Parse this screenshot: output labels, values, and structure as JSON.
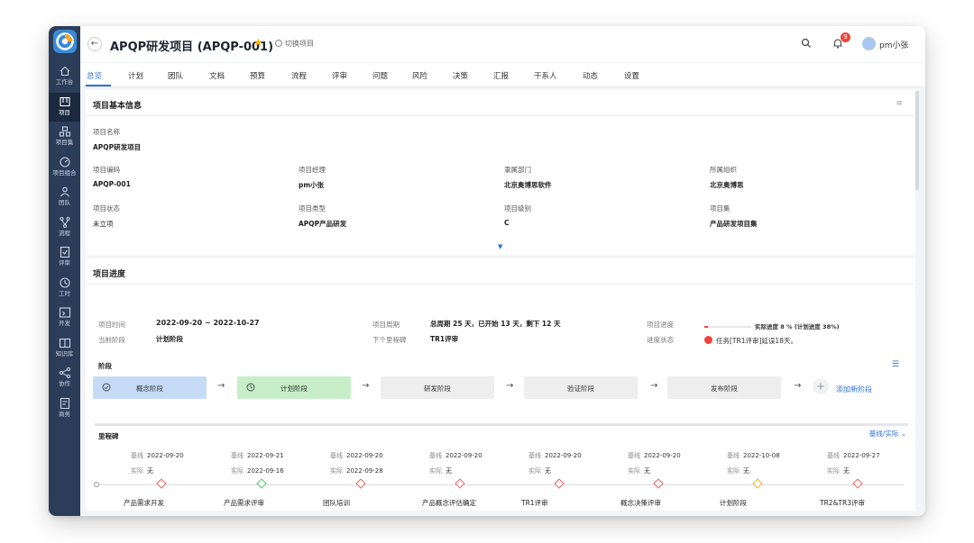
{
  "app": {
    "accent": "#2a6fdb"
  },
  "sidebar": {
    "items": [
      {
        "label": "工作台",
        "icon": "home-icon"
      },
      {
        "label": "项目",
        "icon": "project-icon"
      },
      {
        "label": "项目集",
        "icon": "project-set-icon"
      },
      {
        "label": "项目组合",
        "icon": "portfolio-icon"
      },
      {
        "label": "团队",
        "icon": "team-icon"
      },
      {
        "label": "流程",
        "icon": "process-icon"
      },
      {
        "label": "评审",
        "icon": "review-icon"
      },
      {
        "label": "工时",
        "icon": "clock-icon"
      },
      {
        "label": "开发",
        "icon": "dev-icon"
      },
      {
        "label": "知识库",
        "icon": "knowledge-icon"
      },
      {
        "label": "协作",
        "icon": "share-icon"
      },
      {
        "label": "商务",
        "icon": "business-icon"
      }
    ]
  },
  "header": {
    "back": "←",
    "title": "APQP研发项目 (APQP-001)",
    "star": "★",
    "switch_label": "切换项目",
    "notifications": "9",
    "user": "pm小张"
  },
  "tabs": [
    "总览",
    "计划",
    "团队",
    "文档",
    "预算",
    "流程",
    "评审",
    "问题",
    "风险",
    "决策",
    "汇报",
    "干系人",
    "动态",
    "设置"
  ],
  "basic_info": {
    "title": "项目基本信息",
    "menu_icon": "≡",
    "name_label": "项目名称",
    "name_value": "APQP研发项目",
    "fields": [
      {
        "label": "项目编码",
        "value": "APQP-001"
      },
      {
        "label": "项目经理",
        "value": "pm小张"
      },
      {
        "label": "隶属部门",
        "value": "北京奥博思软件"
      },
      {
        "label": "所属组织",
        "value": "北京奥博思"
      },
      {
        "label": "项目状态",
        "value": "未立项"
      },
      {
        "label": "项目类型",
        "value": "APQP产品研发"
      },
      {
        "label": "项目级别",
        "value": "C"
      },
      {
        "label": "项目集",
        "value": "产品研发项目集"
      }
    ],
    "expand": "▼"
  },
  "progress": {
    "title": "项目进度",
    "time_label": "项目时间",
    "time_value": "2022-09-20 ~ 2022-10-27",
    "phase_label": "当前阶段",
    "phase_value": "计划阶段",
    "cycle_label": "项目周期",
    "cycle_value": "总周期 25 天，已开始 13 天，剩下 12 天",
    "next_label": "下个里程碑",
    "next_value": "TR1评审",
    "prog_label": "项目进度",
    "prog_text": "实际进度 8 %  (计划进度 38%)",
    "actual_pct": 8,
    "status_label": "进度状态",
    "status_value": "任务[TR1评审]延误18天。",
    "status_color": "#f0443a"
  },
  "stages": {
    "title": "阶段",
    "items": [
      {
        "label": "概念阶段",
        "state": "done"
      },
      {
        "label": "计划阶段",
        "state": "cur"
      },
      {
        "label": "研发阶段",
        "state": "todo"
      },
      {
        "label": "验证阶段",
        "state": "todo"
      },
      {
        "label": "发布阶段",
        "state": "todo"
      }
    ],
    "arrow": "→",
    "add_label": "添加新阶段"
  },
  "milestones": {
    "title": "里程碑",
    "mode": "基线/实际 ⌄",
    "base_key": "基线",
    "actual_key": "实际",
    "items": [
      {
        "base": "2022-09-20",
        "actual": "无",
        "name": "产品需求开发",
        "color": "#e8605a"
      },
      {
        "base": "2022-09-21",
        "actual": "2022-09-16",
        "name": "产品需求评审",
        "color": "#5fbf74"
      },
      {
        "base": "2022-09-20",
        "actual": "2022-09-28",
        "name": "团队培训",
        "color": "#e8605a"
      },
      {
        "base": "2022-09-20",
        "actual": "无",
        "name": "产品概念评估确定",
        "color": "#e8605a"
      },
      {
        "base": "2022-09-20",
        "actual": "无",
        "name": "TR1评审",
        "color": "#e8605a"
      },
      {
        "base": "2022-09-20",
        "actual": "无",
        "name": "概念决策评审",
        "color": "#e8605a"
      },
      {
        "base": "2022-10-08",
        "actual": "无",
        "name": "计划阶段",
        "color": "#f2b233"
      },
      {
        "base": "2022-09-27",
        "actual": "无",
        "name": "TR2&TR3评审",
        "color": "#e8605a"
      }
    ]
  }
}
